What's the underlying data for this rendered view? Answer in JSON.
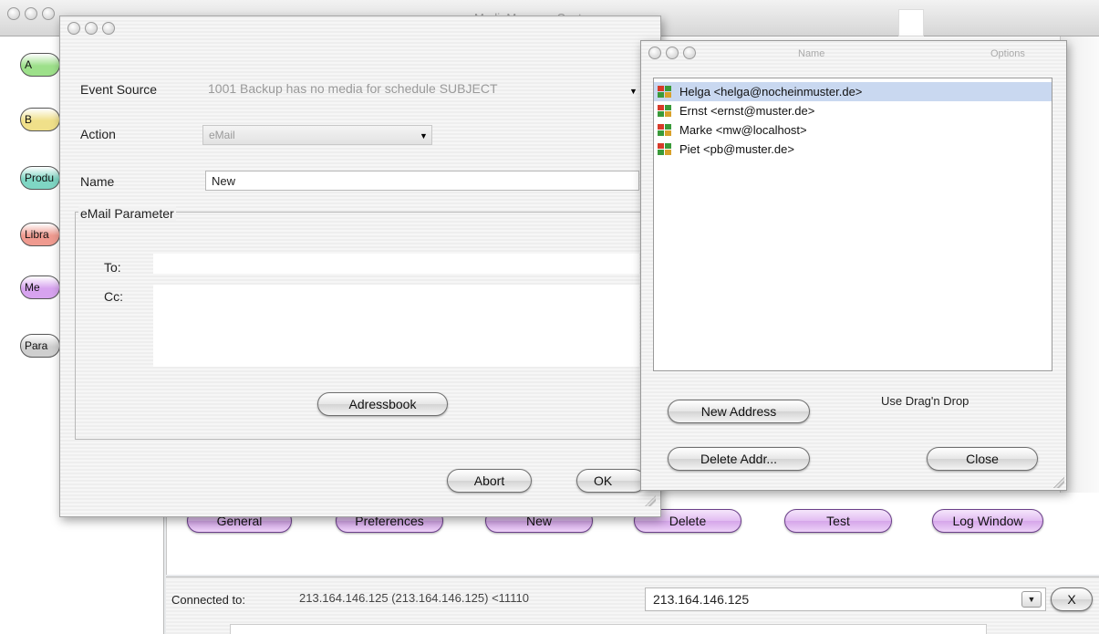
{
  "main_window": {
    "title": "MediaManager Center",
    "side_pills": [
      {
        "label": "A",
        "color": "#9de08a"
      },
      {
        "label": "B",
        "color": "#f0e08a"
      },
      {
        "label": "Produ",
        "color": "#7fd6c4"
      },
      {
        "label": "Libra",
        "color": "#ef9a8f"
      },
      {
        "label": "Me",
        "color": "#d7a3ef"
      },
      {
        "label": "Para",
        "color": "#cfcfcf"
      }
    ],
    "bottom_buttons": {
      "general": "General",
      "preferences": "Preferences",
      "new": "New",
      "delete": "Delete",
      "test": "Test",
      "log_window": "Log Window"
    },
    "connection": {
      "label": "Connected to:",
      "value": "213.164.146.125 (213.164.146.125) <11110",
      "combo_value": "213.164.146.125",
      "close_label": "X"
    }
  },
  "event_dialog": {
    "event_source_label": "Event Source",
    "event_source_value": "1001 Backup has no media for schedule SUBJECT",
    "action_label": "Action",
    "action_value": "eMail",
    "name_label": "Name",
    "name_value": "New",
    "group_title": "eMail Parameter",
    "to_label": "To:",
    "to_value": "",
    "cc_label": "Cc:",
    "cc_value": "",
    "adressbook_button": "Adressbook",
    "abort_button": "Abort",
    "ok_button": "OK"
  },
  "address_window": {
    "col_name": "Name",
    "col_options": "Options",
    "contacts": [
      {
        "label": "Helga <helga@nocheinmuster.de>",
        "selected": true
      },
      {
        "label": "Ernst <ernst@muster.de>",
        "selected": false
      },
      {
        "label": "Marke <mw@localhost>",
        "selected": false
      },
      {
        "label": "Piet <pb@muster.de>",
        "selected": false
      }
    ],
    "hint": "Use Drag'n Drop",
    "new_address_button": "New Address",
    "delete_address_button": "Delete Addr...",
    "close_button": "Close"
  }
}
